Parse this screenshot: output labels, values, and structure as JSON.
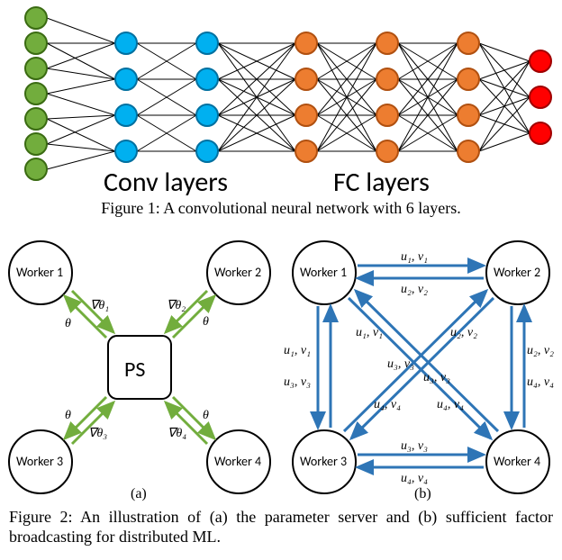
{
  "fig1": {
    "caption_prefix": "Figure 1:",
    "caption_text": " A convolutional neural network with 6 layers.",
    "conv_label": "Conv layers",
    "fc_label": "FC layers"
  },
  "fig2": {
    "caption_prefix": "Figure 2:",
    "caption_text": " An illustration of (a) the parameter server and (b) sufficient factor broadcasting for distributed ML.",
    "ps_label": "PS",
    "sub_a": "(a)",
    "sub_b": "(b)",
    "worker1": "Worker 1",
    "worker2": "Worker 2",
    "worker3": "Worker 3",
    "worker4": "Worker 4",
    "theta": "θ",
    "grad_t1": "∇θ₁",
    "grad_t2": "∇θ₂",
    "grad_t3": "∇θ₃",
    "grad_t4": "∇θ₄",
    "uv1": "u₁, v₁",
    "uv2": "u₂, v₂",
    "uv3": "u₃, v₃",
    "uv4": "u₄, v₄"
  },
  "colors": {
    "green": "#72ad3d",
    "cyan": "#00b0f0",
    "orange": "#ed7d30",
    "red": "#ff0000",
    "ps_green": "#72ad3d",
    "blue": "#2e75b6"
  }
}
